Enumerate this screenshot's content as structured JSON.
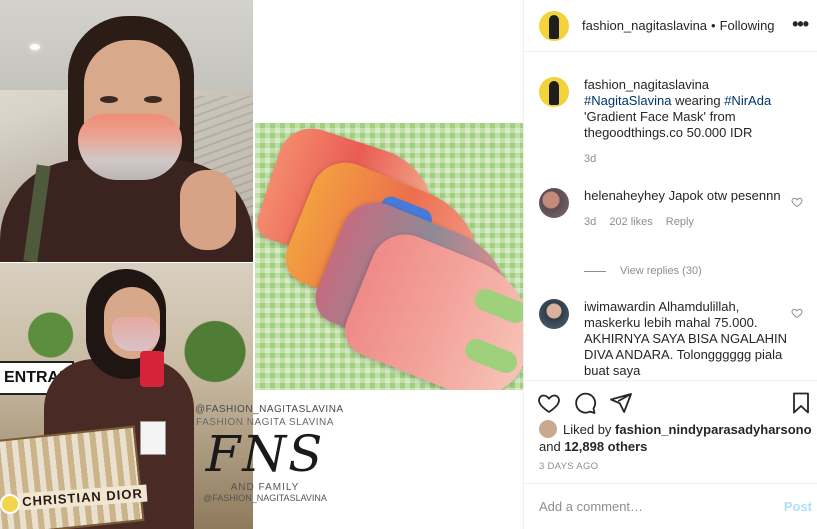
{
  "post": {
    "media": {
      "sign_text": "ENTRAN",
      "bag_text": "CHRISTIAN DIOR",
      "watermark": {
        "handle": "@FASHION_NAGITASLAVINA",
        "name": "FASHION NAGITA SLAVINA",
        "logo": "FNS",
        "family": "AND FAMILY",
        "handle_bottom": "@FASHION_NAGITASLAVINA"
      }
    },
    "header": {
      "username": "fashion_nagitaslavina",
      "separator": "•",
      "follow_label": "Following",
      "more_icon": "more-horizontal-icon"
    },
    "caption": {
      "username": "fashion_nagitaslavina",
      "tag1": "#NagitaSlavina",
      "text1": " wearing ",
      "tag2": "#NirAda",
      "text2": " 'Gradient Face Mask' from thegoodthings.co 50.000 IDR",
      "time": "3d"
    },
    "comments": [
      {
        "username": "helenaheyhey",
        "text": " Japok otw pesennn",
        "time": "3d",
        "likes": "202 likes",
        "reply": "Reply",
        "view_replies": "View replies (30)"
      },
      {
        "username": "iwimawardin",
        "text": " Alhamdulillah, maskerku lebih mahal 75.000. AKHIRNYA SAYA BISA NGALAHIN DIVA ANDARA. Tolongggggg piala buat saya"
      }
    ],
    "likes": {
      "prefix": "Liked by ",
      "user": "fashion_nindyparasadyharsono",
      "middle": " and ",
      "others": "12,898 others"
    },
    "date": "3 DAYS AGO",
    "add_comment": {
      "placeholder": "Add a comment…",
      "post_label": "Post"
    }
  },
  "colors": {
    "link_blue": "#00376b",
    "muted": "#8e8e8e",
    "post_disabled": "#b2dffc",
    "avatar_yellow": "#f2d33c"
  }
}
